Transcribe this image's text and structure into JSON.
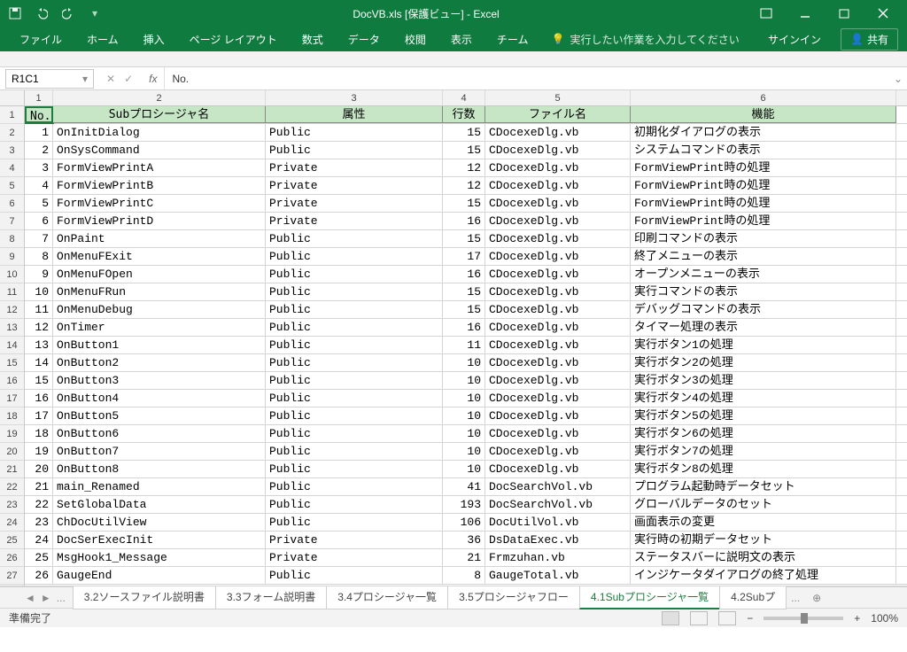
{
  "title": "DocVB.xls  [保護ビュー] - Excel",
  "qat": {
    "save": "保存",
    "undo": "元に戻す",
    "redo": "やり直し"
  },
  "ribbon": {
    "tabs": [
      "ファイル",
      "ホーム",
      "挿入",
      "ページ レイアウト",
      "数式",
      "データ",
      "校閲",
      "表示",
      "チーム"
    ],
    "tellme": "実行したい作業を入力してください",
    "signin": "サインイン",
    "share": "共有"
  },
  "namebox": "R1C1",
  "formula": "No.",
  "colnums": [
    "1",
    "2",
    "3",
    "4",
    "5",
    "6"
  ],
  "headers": {
    "c1": "No.",
    "c2": "Subプロシージャ名",
    "c3": "属性",
    "c4": "行数",
    "c5": "ファイル名",
    "c6": "機能"
  },
  "rows": [
    {
      "n": "1",
      "name": "OnInitDialog",
      "attr": "Public",
      "lines": "15",
      "file": "CDocexeDlg.vb",
      "func": "初期化ダイアログの表示"
    },
    {
      "n": "2",
      "name": "OnSysCommand",
      "attr": "Public",
      "lines": "15",
      "file": "CDocexeDlg.vb",
      "func": "システムコマンドの表示"
    },
    {
      "n": "3",
      "name": "FormViewPrintA",
      "attr": "Private",
      "lines": "12",
      "file": "CDocexeDlg.vb",
      "func": "FormViewPrint時の処理"
    },
    {
      "n": "4",
      "name": "FormViewPrintB",
      "attr": "Private",
      "lines": "12",
      "file": "CDocexeDlg.vb",
      "func": "FormViewPrint時の処理"
    },
    {
      "n": "5",
      "name": "FormViewPrintC",
      "attr": "Private",
      "lines": "15",
      "file": "CDocexeDlg.vb",
      "func": "FormViewPrint時の処理"
    },
    {
      "n": "6",
      "name": "FormViewPrintD",
      "attr": "Private",
      "lines": "16",
      "file": "CDocexeDlg.vb",
      "func": "FormViewPrint時の処理"
    },
    {
      "n": "7",
      "name": "OnPaint",
      "attr": "Public",
      "lines": "15",
      "file": "CDocexeDlg.vb",
      "func": "印刷コマンドの表示"
    },
    {
      "n": "8",
      "name": "OnMenuFExit",
      "attr": "Public",
      "lines": "17",
      "file": "CDocexeDlg.vb",
      "func": "終了メニューの表示"
    },
    {
      "n": "9",
      "name": "OnMenuFOpen",
      "attr": "Public",
      "lines": "16",
      "file": "CDocexeDlg.vb",
      "func": "オープンメニューの表示"
    },
    {
      "n": "10",
      "name": "OnMenuFRun",
      "attr": "Public",
      "lines": "15",
      "file": "CDocexeDlg.vb",
      "func": "実行コマンドの表示"
    },
    {
      "n": "11",
      "name": "OnMenuDebug",
      "attr": "Public",
      "lines": "15",
      "file": "CDocexeDlg.vb",
      "func": "デバッグコマンドの表示"
    },
    {
      "n": "12",
      "name": "OnTimer",
      "attr": "Public",
      "lines": "16",
      "file": "CDocexeDlg.vb",
      "func": "タイマー処理の表示"
    },
    {
      "n": "13",
      "name": "OnButton1",
      "attr": "Public",
      "lines": "11",
      "file": "CDocexeDlg.vb",
      "func": "実行ボタン1の処理"
    },
    {
      "n": "14",
      "name": "OnButton2",
      "attr": "Public",
      "lines": "10",
      "file": "CDocexeDlg.vb",
      "func": "実行ボタン2の処理"
    },
    {
      "n": "15",
      "name": "OnButton3",
      "attr": "Public",
      "lines": "10",
      "file": "CDocexeDlg.vb",
      "func": "実行ボタン3の処理"
    },
    {
      "n": "16",
      "name": "OnButton4",
      "attr": "Public",
      "lines": "10",
      "file": "CDocexeDlg.vb",
      "func": "実行ボタン4の処理"
    },
    {
      "n": "17",
      "name": "OnButton5",
      "attr": "Public",
      "lines": "10",
      "file": "CDocexeDlg.vb",
      "func": "実行ボタン5の処理"
    },
    {
      "n": "18",
      "name": "OnButton6",
      "attr": "Public",
      "lines": "10",
      "file": "CDocexeDlg.vb",
      "func": "実行ボタン6の処理"
    },
    {
      "n": "19",
      "name": "OnButton7",
      "attr": "Public",
      "lines": "10",
      "file": "CDocexeDlg.vb",
      "func": "実行ボタン7の処理"
    },
    {
      "n": "20",
      "name": "OnButton8",
      "attr": "Public",
      "lines": "10",
      "file": "CDocexeDlg.vb",
      "func": "実行ボタン8の処理"
    },
    {
      "n": "21",
      "name": "main_Renamed",
      "attr": "Public",
      "lines": "41",
      "file": "DocSearchVol.vb",
      "func": "プログラム起動時データセット"
    },
    {
      "n": "22",
      "name": "SetGlobalData",
      "attr": "Public",
      "lines": "193",
      "file": "DocSearchVol.vb",
      "func": "グローバルデータのセット"
    },
    {
      "n": "23",
      "name": "ChDocUtilView",
      "attr": "Public",
      "lines": "106",
      "file": "DocUtilVol.vb",
      "func": "画面表示の変更"
    },
    {
      "n": "24",
      "name": "DocSerExecInit",
      "attr": "Private",
      "lines": "36",
      "file": "DsDataExec.vb",
      "func": "実行時の初期データセット"
    },
    {
      "n": "25",
      "name": "MsgHook1_Message",
      "attr": "Private",
      "lines": "21",
      "file": "Frmzuhan.vb",
      "func": "ステータスバーに説明文の表示"
    },
    {
      "n": "26",
      "name": "GaugeEnd",
      "attr": "Public",
      "lines": "8",
      "file": "GaugeTotal.vb",
      "func": "インジケータダイアログの終了処理"
    }
  ],
  "sheettabs": {
    "list": [
      "3.2ソースファイル説明書",
      "3.3フォーム説明書",
      "3.4プロシージャ一覧",
      "3.5プロシージャフロー",
      "4.1Subプロシージャ一覧",
      "4.2Subプ"
    ],
    "active": 4,
    "ellipsis": "..."
  },
  "statusbar": {
    "ready": "準備完了",
    "zoom": "100%",
    "plus": "+",
    "minus": "−"
  }
}
